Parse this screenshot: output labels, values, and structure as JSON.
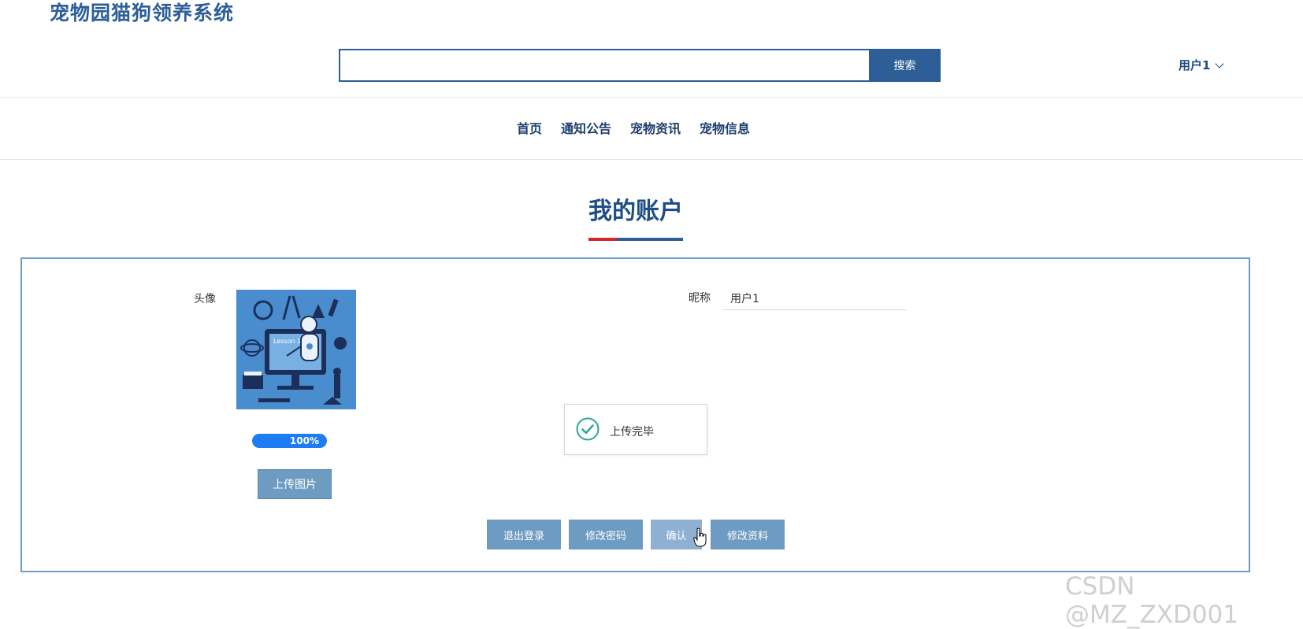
{
  "header": {
    "site_title": "宠物园猫狗领养系统",
    "search": {
      "placeholder": "",
      "button_label": "搜索"
    },
    "user_menu": {
      "label": "用户1"
    }
  },
  "nav": {
    "items": [
      "首页",
      "通知公告",
      "宠物资讯",
      "宠物信息"
    ]
  },
  "page": {
    "title": "我的账户"
  },
  "profile": {
    "avatar_label": "头像",
    "avatar_image_text": "Lesson 1",
    "upload_progress": "100%",
    "upload_progress_value": 1.0,
    "upload_button": "上传图片",
    "nickname_label": "昵称",
    "nickname_value": "用户1"
  },
  "toast": {
    "message": "上传完毕"
  },
  "actions": {
    "logout": "退出登录",
    "change_password": "修改密码",
    "confirm": "确认",
    "edit_profile": "修改资料"
  },
  "watermark": "CSDN @MZ_ZXD001",
  "colors": {
    "primary": "#2d5e98",
    "button": "#6e9bc2",
    "accent_red": "#d6262b",
    "progress": "#1e7cf2",
    "success": "#2aa79b"
  }
}
